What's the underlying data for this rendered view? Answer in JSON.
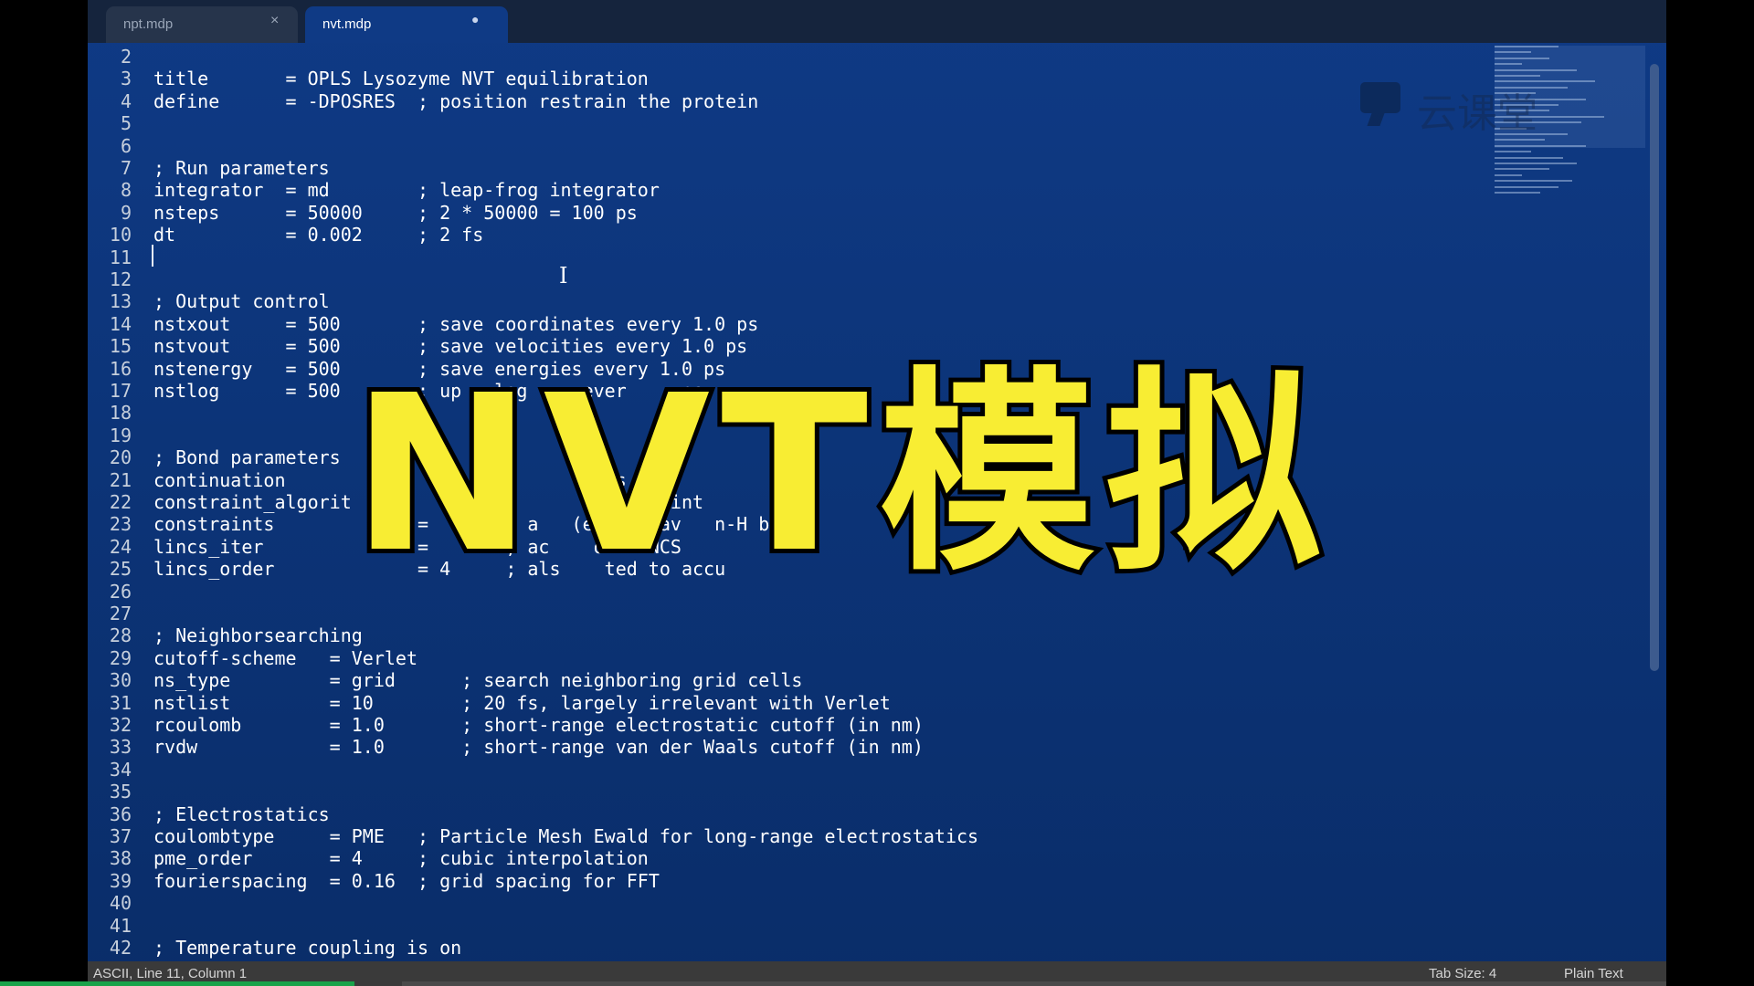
{
  "tabs": [
    {
      "label": "npt.mdp",
      "control": "×"
    },
    {
      "label": "nvt.mdp",
      "control": "●"
    }
  ],
  "lines": [
    {
      "n": "2",
      "text": ""
    },
    {
      "n": "3",
      "text": "title       = OPLS Lysozyme NVT equilibration"
    },
    {
      "n": "4",
      "text": "define      = -DPOSRES  ; position restrain the protein"
    },
    {
      "n": "5",
      "text": ""
    },
    {
      "n": "6",
      "text": ""
    },
    {
      "n": "7",
      "text": "; Run parameters"
    },
    {
      "n": "8",
      "text": "integrator  = md        ; leap-frog integrator"
    },
    {
      "n": "9",
      "text": "nsteps      = 50000     ; 2 * 50000 = 100 ps"
    },
    {
      "n": "10",
      "text": "dt          = 0.002     ; 2 fs"
    },
    {
      "n": "11",
      "text": ""
    },
    {
      "n": "12",
      "text": ""
    },
    {
      "n": "13",
      "text": "; Output control"
    },
    {
      "n": "14",
      "text": "nstxout     = 500       ; save coordinates every 1.0 ps"
    },
    {
      "n": "15",
      "text": "nstvout     = 500       ; save velocities every 1.0 ps"
    },
    {
      "n": "16",
      "text": "nstenergy   = 500       ; save energies every 1.0 ps"
    },
    {
      "n": "17",
      "text": "nstlog      = 500       ; up   log     ever     ps"
    },
    {
      "n": "18",
      "text": ""
    },
    {
      "n": "19",
      "text": ""
    },
    {
      "n": "20",
      "text": "; Bond parameters"
    },
    {
      "n": "21",
      "text": "continuation                 ;          ics run"
    },
    {
      "n": "22",
      "text": "constraint_algorit           ; h        constraint"
    },
    {
      "n": "23",
      "text": "constraints             =    ds ; a   (even heav   n-H bonc"
    },
    {
      "n": "24",
      "text": "lincs_iter              =       ; ac    of LINCS"
    },
    {
      "n": "25",
      "text": "lincs_order             = 4     ; als    ted to accu"
    },
    {
      "n": "26",
      "text": ""
    },
    {
      "n": "27",
      "text": ""
    },
    {
      "n": "28",
      "text": "; Neighborsearching"
    },
    {
      "n": "29",
      "text": "cutoff-scheme   = Verlet"
    },
    {
      "n": "30",
      "text": "ns_type         = grid      ; search neighboring grid cells"
    },
    {
      "n": "31",
      "text": "nstlist         = 10        ; 20 fs, largely irrelevant with Verlet"
    },
    {
      "n": "32",
      "text": "rcoulomb        = 1.0       ; short-range electrostatic cutoff (in nm)"
    },
    {
      "n": "33",
      "text": "rvdw            = 1.0       ; short-range van der Waals cutoff (in nm)"
    },
    {
      "n": "34",
      "text": ""
    },
    {
      "n": "35",
      "text": ""
    },
    {
      "n": "36",
      "text": "; Electrostatics"
    },
    {
      "n": "37",
      "text": "coulombtype     = PME   ; Particle Mesh Ewald for long-range electrostatics"
    },
    {
      "n": "38",
      "text": "pme_order       = 4     ; cubic interpolation"
    },
    {
      "n": "39",
      "text": "fourierspacing  = 0.16  ; grid spacing for FFT"
    },
    {
      "n": "40",
      "text": ""
    },
    {
      "n": "41",
      "text": ""
    },
    {
      "n": "42",
      "text": "; Temperature coupling is on"
    }
  ],
  "overlay_title": "NVT模拟",
  "watermark_text": "云课堂",
  "status": {
    "left": "ASCII, Line 11, Column 1",
    "tab_size": "Tab Size: 4",
    "syntax": "Plain Text"
  },
  "colors": {
    "editor_bg": "#0f3a85",
    "overlay_text": "#f8ed33",
    "progress": "#19a34a"
  }
}
